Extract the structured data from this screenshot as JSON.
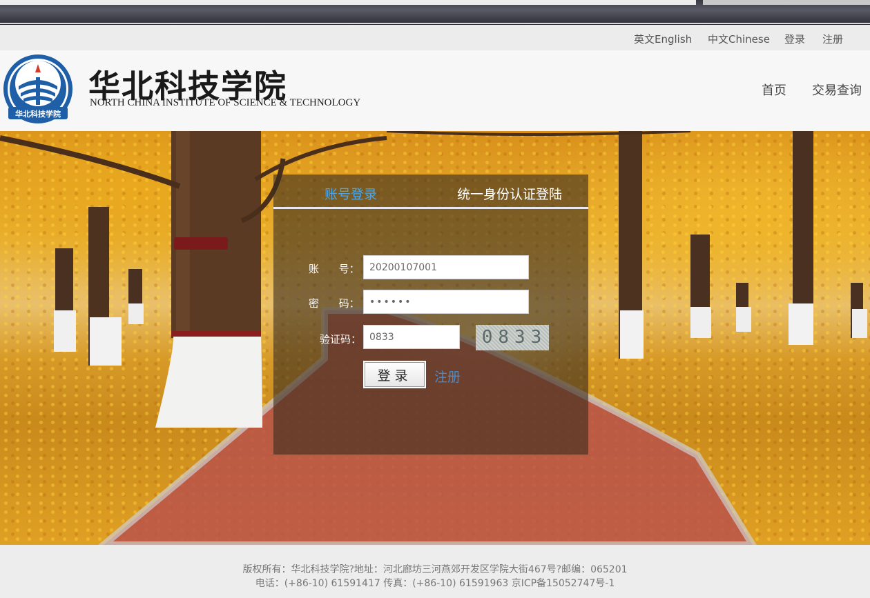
{
  "top_links": {
    "english": "英文English",
    "chinese": "中文Chinese",
    "login": "登录",
    "register": "注册"
  },
  "header": {
    "logo_cn": "华北科技学院",
    "logo_en": "NORTH CHINA INSTITUTE OF SCIENCE & TECHNOLOGY",
    "seal_text": "华北科技学院",
    "nav": {
      "home": "首页",
      "transactions": "交易查询"
    }
  },
  "login": {
    "tabs": {
      "account": "账号登录",
      "unified": "统一身份认证登陆"
    },
    "account_label": "账      号：",
    "account_value": "20200107001",
    "password_label": "密      码：",
    "password_value": "••••••",
    "captcha_label": "验证码：",
    "captcha_value": "0833",
    "captcha_image_text": "0833",
    "submit_label": "登录",
    "register_label": "注册"
  },
  "footer": {
    "line1": "版权所有：华北科技学院?地址：河北廊坊三河燕郊开发区学院大街467号?邮编：065201",
    "line2": "电话：(+86-10) 61591417 传真：(+86-10) 61591963 京ICP备15052747号-1"
  },
  "colors": {
    "tab_active": "#4aa6e8",
    "link_blue": "#3d8fd6",
    "seal_blue": "#1f5fa8"
  }
}
